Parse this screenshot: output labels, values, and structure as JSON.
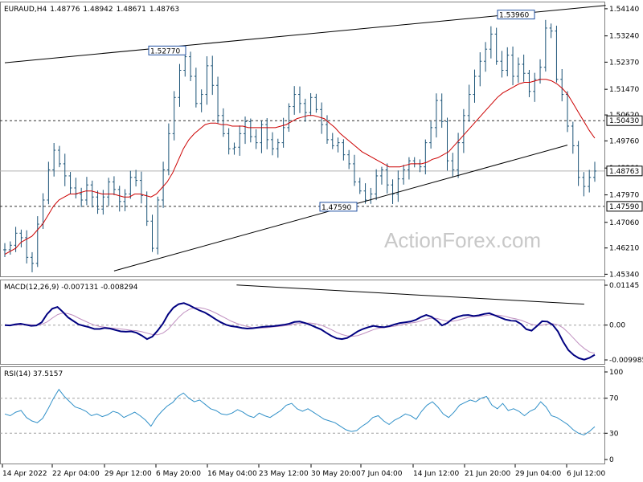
{
  "chart_data": [
    {
      "type": "line",
      "subtype": "ohlc",
      "title": "EURAUD,H4",
      "ohlc": {
        "open": "1.48776",
        "high": "1.48942",
        "low": "1.48671",
        "close": "1.48763"
      },
      "ylim": [
        1.4527,
        1.5435
      ],
      "y_ticks": [
        "1.54140",
        "1.53240",
        "1.52370",
        "1.51470",
        "1.50620",
        "1.49760",
        "1.48860",
        "1.47970",
        "1.47060",
        "1.46210",
        "1.45340"
      ],
      "x_ticks": [
        "14 Apr 2022",
        "22 Apr 04:00",
        "29 Apr 12:00",
        "6 May 20:00",
        "16 May 04:00",
        "23 May 12:00",
        "30 May 20:00",
        "7 Jun 04:00",
        "14 Jun 12:00",
        "21 Jun 20:00",
        "29 Jun 04:00",
        "6 Jul 12:00"
      ],
      "price": [
        1.4615,
        1.463,
        1.467,
        1.4655,
        1.459,
        1.457,
        1.47,
        1.478,
        1.488,
        1.4945,
        1.49,
        1.486,
        1.482,
        1.48,
        1.478,
        1.483,
        1.479,
        1.475,
        1.479,
        1.484,
        1.4815,
        1.4775,
        1.48,
        1.4855,
        1.4845,
        1.4795,
        1.471,
        1.462,
        1.478,
        1.488,
        1.5,
        1.512,
        1.521,
        1.5255,
        1.519,
        1.51,
        1.513,
        1.5225,
        1.516,
        1.506,
        1.5,
        1.495,
        1.4955,
        1.5,
        1.504,
        1.499,
        1.497,
        1.503,
        1.498,
        1.495,
        1.497,
        1.502,
        1.509,
        1.513,
        1.51,
        1.507,
        1.512,
        1.508,
        1.503,
        1.498,
        1.496,
        1.497,
        1.493,
        1.49,
        1.484,
        1.481,
        1.478,
        1.48,
        1.486,
        1.488,
        1.483,
        1.48,
        1.485,
        1.488,
        1.491,
        1.49,
        1.489,
        1.497,
        1.502,
        1.511,
        1.504,
        1.491,
        1.488,
        1.497,
        1.506,
        1.513,
        1.519,
        1.524,
        1.528,
        1.533,
        1.524,
        1.521,
        1.526,
        1.519,
        1.523,
        1.52,
        1.514,
        1.518,
        1.522,
        1.535,
        1.534,
        1.518,
        1.513,
        1.5025,
        1.496,
        1.4855,
        1.4825,
        1.4855,
        1.4876
      ],
      "series": [
        {
          "name": "",
          "values": [
            1.46,
            1.461,
            1.462,
            1.464,
            1.465,
            1.466,
            1.468,
            1.47,
            1.473,
            1.476,
            1.478,
            1.479,
            1.48,
            1.48,
            1.4805,
            1.481,
            1.481,
            1.4805,
            1.48,
            1.48,
            1.48,
            1.4795,
            1.479,
            1.479,
            1.48,
            1.48,
            1.4795,
            1.479,
            1.48,
            1.482,
            1.484,
            1.487,
            1.491,
            1.495,
            1.498,
            1.5,
            1.5015,
            1.503,
            1.5035,
            1.5035,
            1.503,
            1.503,
            1.5025,
            1.5025,
            1.5025,
            1.502,
            1.502,
            1.502,
            1.502,
            1.502,
            1.502,
            1.5025,
            1.503,
            1.504,
            1.505,
            1.5055,
            1.506,
            1.506,
            1.5055,
            1.505,
            1.5035,
            1.502,
            1.5,
            1.4985,
            1.497,
            1.4955,
            1.494,
            1.493,
            1.492,
            1.491,
            1.49,
            1.489,
            1.489,
            1.489,
            1.4895,
            1.49,
            1.49,
            1.49,
            1.4905,
            1.4915,
            1.492,
            1.493,
            1.494,
            1.496,
            1.498,
            1.5,
            1.502,
            1.504,
            1.506,
            1.508,
            1.51,
            1.512,
            1.5135,
            1.5145,
            1.5155,
            1.5165,
            1.517,
            1.517,
            1.5175,
            1.518,
            1.518,
            1.5175,
            1.5165,
            1.515,
            1.513,
            1.51,
            1.507,
            1.504,
            1.501,
            1.4985
          ]
        }
      ],
      "price_labels": [
        "1.52770",
        "1.53960",
        "1.47590",
        "1.50430",
        "1.48763"
      ],
      "hlines": [
        1.5043,
        1.4759
      ],
      "trendlines": [
        {
          "from": [
            0,
            1.5235
          ],
          "to": [
            110,
            1.5425
          ]
        },
        {
          "from": [
            20,
            1.4545
          ],
          "to": [
            103,
            1.4962
          ]
        }
      ]
    },
    {
      "type": "line",
      "title": "MACD(12,26,9) -0.007131 -0.008294",
      "ylim": [
        -0.0109,
        0.0126
      ],
      "y_ticks": [
        "0.01145",
        "0.00",
        "-0.009985"
      ],
      "zero_line": 0,
      "series": [
        {
          "name": "",
          "values": [
            0.0,
            -0.0001,
            0.0002,
            0.0004,
            0.0001,
            -0.0002,
            -0.0001,
            0.0008,
            0.0031,
            0.0047,
            0.0052,
            0.0038,
            0.0022,
            0.0012,
            0.0002,
            -0.0002,
            -0.0006,
            -0.0011,
            -0.0011,
            -0.0008,
            -0.001,
            -0.0014,
            -0.0018,
            -0.0019,
            -0.0018,
            -0.0022,
            -0.003,
            -0.004,
            -0.0033,
            -0.0016,
            0.0004,
            0.0031,
            0.005,
            0.006,
            0.0063,
            0.0057,
            0.0049,
            0.0042,
            0.0036,
            0.0027,
            0.0017,
            0.0008,
            0.0001,
            -0.0003,
            -0.0005,
            -0.0008,
            -0.001,
            -0.0009,
            -0.0007,
            -0.0005,
            -0.0004,
            -0.0003,
            -0.0001,
            0.0001,
            0.0004,
            0.0009,
            0.001,
            0.0006,
            0.0001,
            -0.0006,
            -0.0012,
            -0.0022,
            -0.0031,
            -0.0038,
            -0.004,
            -0.0037,
            -0.0028,
            -0.0018,
            -0.0011,
            -0.0006,
            -0.0002,
            -0.0005,
            -0.0006,
            -0.0003,
            0.0002,
            0.0006,
            0.0008,
            0.001,
            0.0015,
            0.0023,
            0.0029,
            0.0024,
            0.0013,
            -0.0001,
            0.0006,
            0.0018,
            0.0024,
            0.0028,
            0.0029,
            0.0026,
            0.0028,
            0.0032,
            0.0034,
            0.0028,
            0.0022,
            0.0016,
            0.0013,
            0.0012,
            0.0003,
            -0.0012,
            -0.0016,
            -0.0003,
            0.0011,
            0.001,
            0.0001,
            -0.0018,
            -0.0048,
            -0.0072,
            -0.0086,
            -0.0095,
            -0.0099,
            -0.0094,
            -0.0085
          ]
        },
        {
          "name": "",
          "values": [
            0.0001,
            0.0,
            0.0,
            0.0001,
            0.0002,
            0.0001,
            0.0,
            0.0002,
            0.0009,
            0.002,
            0.003,
            0.0035,
            0.0033,
            0.0028,
            0.002,
            0.0013,
            0.0006,
            0.0,
            -0.0004,
            -0.0006,
            -0.0008,
            -0.0009,
            -0.0011,
            -0.0013,
            -0.0015,
            -0.0016,
            -0.0019,
            -0.0023,
            -0.0027,
            -0.0028,
            -0.0023,
            -0.0012,
            0.0005,
            0.0022,
            0.0036,
            0.0045,
            0.005,
            0.005,
            0.0047,
            0.0042,
            0.0035,
            0.0027,
            0.0019,
            0.0011,
            0.0005,
            0.0,
            -0.0004,
            -0.0007,
            -0.0008,
            -0.0008,
            -0.0007,
            -0.0005,
            -0.0004,
            -0.0002,
            0.0,
            0.0003,
            0.0005,
            0.0006,
            0.0006,
            0.0004,
            0.0,
            -0.0006,
            -0.0013,
            -0.0021,
            -0.0027,
            -0.0031,
            -0.0032,
            -0.003,
            -0.0025,
            -0.0019,
            -0.0013,
            -0.0009,
            -0.0007,
            -0.0005,
            -0.0003,
            0.0,
            0.0003,
            0.0006,
            0.0008,
            0.0012,
            0.0017,
            0.002,
            0.0019,
            0.0015,
            0.0011,
            0.0011,
            0.0014,
            0.0018,
            0.0022,
            0.0024,
            0.0025,
            0.0027,
            0.0029,
            0.0029,
            0.0028,
            0.0025,
            0.0021,
            0.0018,
            0.0014,
            0.0008,
            0.0002,
            -0.0001,
            0.0,
            0.0003,
            0.0004,
            0.0001,
            -0.0008,
            -0.0022,
            -0.0038,
            -0.0054,
            -0.0067,
            -0.0077,
            -0.0081
          ]
        }
      ],
      "trendlines": [
        {
          "from": [
            44,
            0.0115
          ],
          "to": [
            110,
            0.006
          ]
        }
      ]
    },
    {
      "type": "line",
      "title": "RSI(14) 37.5157",
      "ylim": [
        0,
        100
      ],
      "y_ticks": [
        "100",
        "70",
        "30",
        "0"
      ],
      "levels": [
        70,
        30
      ],
      "series": [
        {
          "name": "",
          "values": [
            52,
            50,
            54,
            56,
            48,
            44,
            42,
            47,
            58,
            70,
            80,
            72,
            66,
            60,
            58,
            55,
            50,
            52,
            49,
            51,
            55,
            53,
            48,
            51,
            54,
            50,
            45,
            38,
            48,
            55,
            61,
            65,
            72,
            76,
            70,
            66,
            68,
            63,
            58,
            56,
            52,
            51,
            53,
            57,
            54,
            50,
            48,
            53,
            50,
            48,
            52,
            56,
            62,
            64,
            58,
            55,
            58,
            54,
            50,
            46,
            44,
            42,
            38,
            34,
            32,
            33,
            38,
            42,
            48,
            50,
            44,
            40,
            45,
            48,
            52,
            50,
            46,
            55,
            62,
            66,
            60,
            52,
            48,
            54,
            62,
            65,
            68,
            66,
            70,
            72,
            62,
            58,
            64,
            56,
            58,
            55,
            50,
            55,
            58,
            66,
            60,
            50,
            48,
            44,
            40,
            34,
            30,
            28,
            32,
            37.5
          ]
        }
      ]
    }
  ],
  "watermark": "ActionForex.com",
  "colors": {
    "price": "#1a5276",
    "ma": "#cc0000",
    "macd": "#000080",
    "signal": "#c090c0",
    "rsi": "#3090c8",
    "grid": "#a0a0a0"
  }
}
